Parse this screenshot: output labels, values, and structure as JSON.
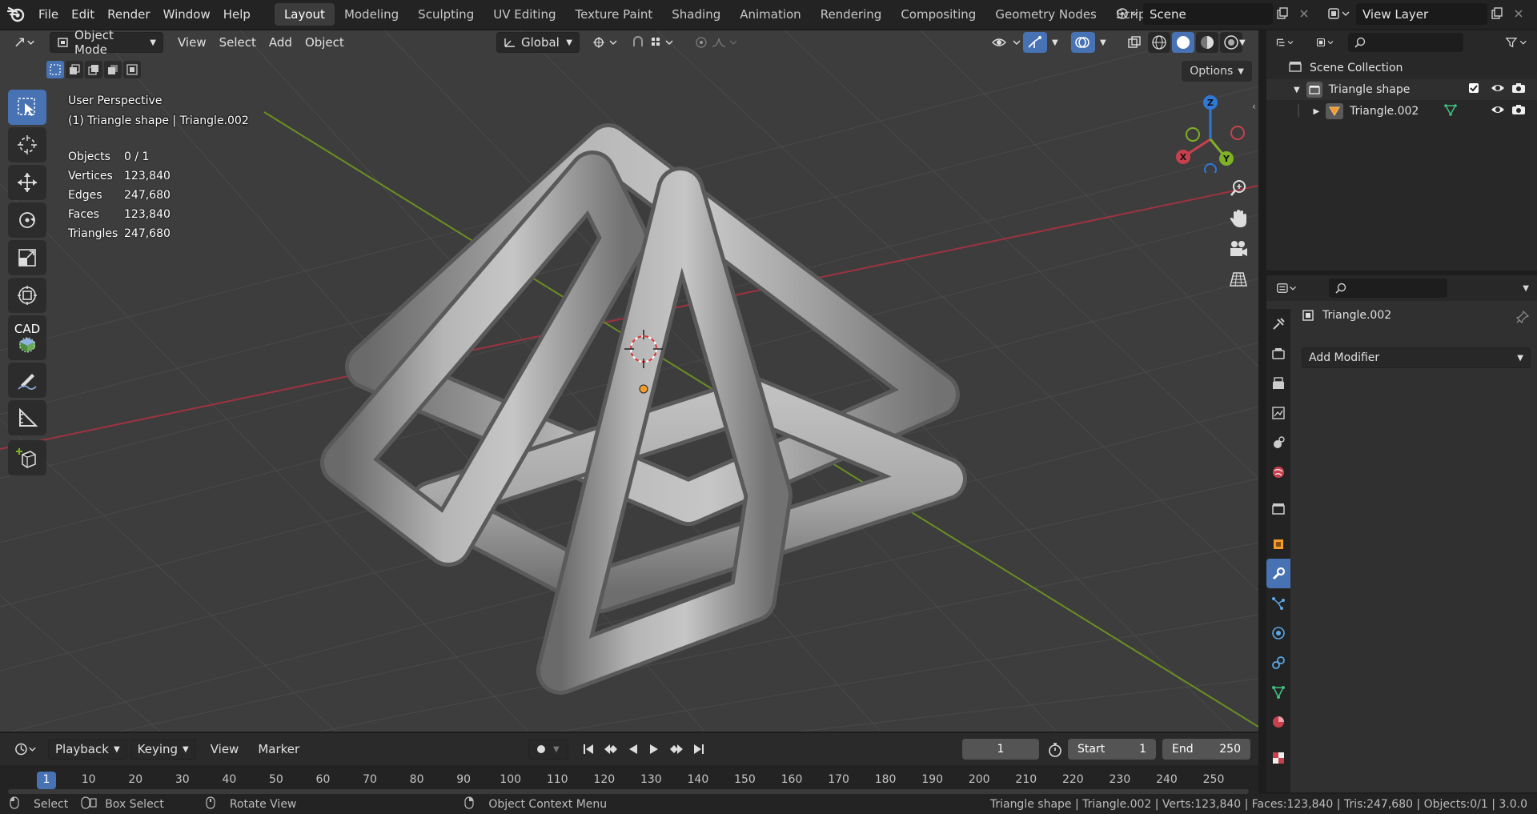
{
  "topbar": {
    "menus": [
      "File",
      "Edit",
      "Render",
      "Window",
      "Help"
    ],
    "workspaces": [
      "Layout",
      "Modeling",
      "Sculpting",
      "UV Editing",
      "Texture Paint",
      "Shading",
      "Animation",
      "Rendering",
      "Compositing",
      "Geometry Nodes",
      "Scripting"
    ],
    "more": "·",
    "scene": "Scene",
    "view_layer": "View Layer"
  },
  "viewport": {
    "mode": "Object Mode",
    "menus": [
      "View",
      "Select",
      "Add",
      "Object"
    ],
    "orientation": "Global",
    "options": "Options",
    "perspective": "User Perspective",
    "active": "(1) Triangle shape | Triangle.002",
    "stats": [
      {
        "label": "Objects",
        "value": "0 / 1"
      },
      {
        "label": "Vertices",
        "value": "123,840"
      },
      {
        "label": "Edges",
        "value": "247,680"
      },
      {
        "label": "Faces",
        "value": "123,840"
      },
      {
        "label": "Triangles",
        "value": "247,680"
      }
    ],
    "cad_label": "CAD",
    "gizmo": {
      "x": "X",
      "y": "Y",
      "z": "Z"
    }
  },
  "timeline": {
    "menus": [
      "Playback",
      "Keying",
      "View",
      "Marker"
    ],
    "current_frame": "1",
    "start_label": "Start",
    "start": "1",
    "end_label": "End",
    "end": "250",
    "ticks": [
      "1",
      "10",
      "20",
      "30",
      "40",
      "50",
      "60",
      "70",
      "80",
      "90",
      "100",
      "110",
      "120",
      "130",
      "140",
      "150",
      "160",
      "170",
      "180",
      "190",
      "200",
      "210",
      "220",
      "230",
      "240",
      "250"
    ]
  },
  "statusbar": {
    "select": "Select",
    "box_select": "Box Select",
    "rotate": "Rotate View",
    "context": "Object Context Menu",
    "info": "Triangle shape | Triangle.002 | Verts:123,840 | Faces:123,840 | Tris:247,680 | Objects:0/1 | 3.0.0"
  },
  "outliner": {
    "root": "Scene Collection",
    "collection": "Triangle shape",
    "object": "Triangle.002"
  },
  "properties": {
    "object": "Triangle.002",
    "add_modifier": "Add Modifier"
  },
  "colors": {
    "accent": "#4772b3",
    "x_axis": "#c8404e",
    "y_axis": "#7fb025",
    "z_axis": "#2f78d6"
  }
}
